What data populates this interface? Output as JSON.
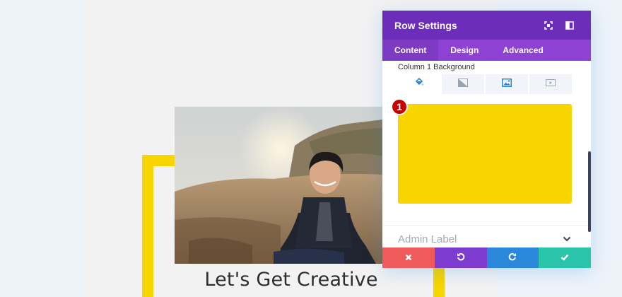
{
  "hero": {
    "heading": "Let's Get Creative"
  },
  "panel": {
    "title": "Row Settings",
    "tabs": [
      {
        "label": "Content",
        "active": true
      },
      {
        "label": "Design",
        "active": false
      },
      {
        "label": "Advanced",
        "active": false
      }
    ],
    "section_label": "Column 1 Background",
    "background_types": [
      "color-fill-icon",
      "gradient-icon",
      "image-icon",
      "video-icon"
    ],
    "background_color": "#f8d400",
    "step_badge": "1",
    "admin_label": "Admin Label",
    "footer_actions": [
      "discard",
      "undo",
      "redo",
      "save"
    ]
  },
  "colors": {
    "header": "#6c2eb9",
    "tabs": "#8e42d3",
    "discard": "#ef5b5b",
    "undo": "#7e3bd0",
    "redo": "#2b87da",
    "save": "#29c4a9",
    "accent": "#f8d400"
  }
}
